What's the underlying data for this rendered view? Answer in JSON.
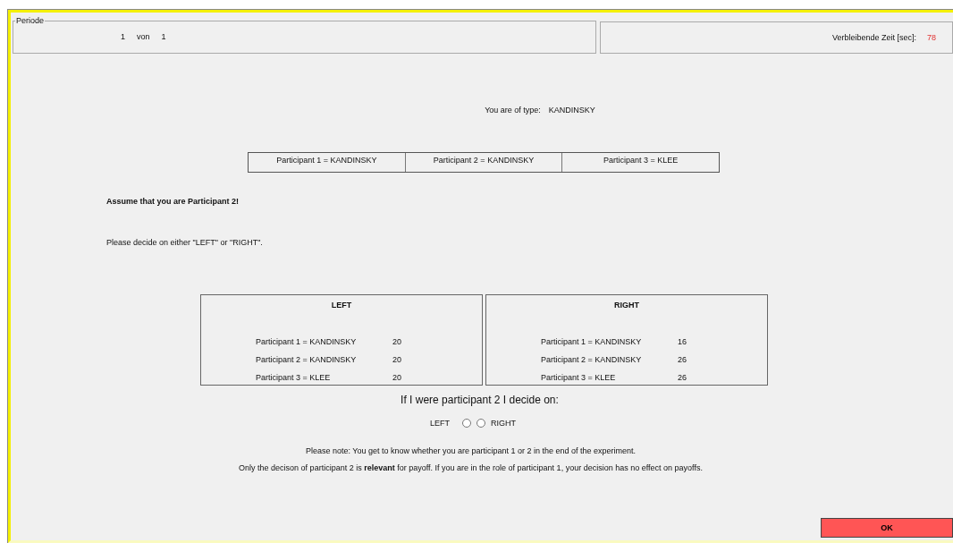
{
  "period": {
    "legend": "Periode",
    "current": "1",
    "separator": "von",
    "total": "1"
  },
  "timer": {
    "label": "Verbleibende Zeit [sec]:",
    "value": "78"
  },
  "type_line": {
    "label": "You are of type:",
    "value": "KANDINSKY"
  },
  "participants": [
    "Participant 1 = KANDINSKY",
    "Participant 2 = KANDINSKY",
    "Participant 3 = KLEE"
  ],
  "assume": "Assume that you are Participant 2!",
  "instruction": "Please decide on  either \"LEFT\" or \"RIGHT\".",
  "options": [
    {
      "title": "LEFT",
      "rows": [
        {
          "label": "Participant 1 = KANDINSKY",
          "payoff": "20"
        },
        {
          "label": "Participant 2 = KANDINSKY",
          "payoff": "20"
        },
        {
          "label": "Participant 3 = KLEE",
          "payoff": "20"
        }
      ]
    },
    {
      "title": "RIGHT",
      "rows": [
        {
          "label": "Participant 1 = KANDINSKY",
          "payoff": "16"
        },
        {
          "label": "Participant 2 = KANDINSKY",
          "payoff": "26"
        },
        {
          "label": "Participant 3 = KLEE",
          "payoff": "26"
        }
      ]
    }
  ],
  "question": "If I were participant 2 I decide on:",
  "choices": [
    {
      "label": "LEFT",
      "selected": false
    },
    {
      "label": "RIGHT",
      "selected": false
    }
  ],
  "notes": [
    "Please note: You get to know whether you are participant 1 or 2 in the end of the experiment.",
    "Only the decison of participant 2 is **relevant** for payoff. If you are in the role of participant 1, your decision has no effect on payoffs."
  ],
  "ok_button": "OK"
}
